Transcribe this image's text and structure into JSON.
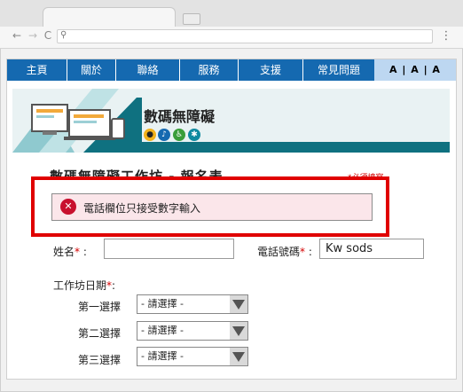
{
  "browser": {
    "back_glyph": "←",
    "forward_glyph": "→",
    "reload_glyph": "C",
    "search_glyph": "⚲",
    "menu_glyph": "⋮"
  },
  "navbar": {
    "items": [
      {
        "label": "主頁"
      },
      {
        "label": "關於"
      },
      {
        "label": "聯絡"
      },
      {
        "label": "服務"
      },
      {
        "label": "支援"
      },
      {
        "label": "常見問題"
      }
    ],
    "font_size_controls": "A | A | A",
    "color": "#1569b0"
  },
  "banner": {
    "title": "數碼無障礙",
    "icons": [
      "eye-icon",
      "hearing-icon",
      "wheelchair-icon",
      "cognitive-icon"
    ]
  },
  "form": {
    "title": "數碼無障礙工作坊 - 報名表",
    "required_note": "*必須填寫",
    "error_message": "電話欄位只接受數字輸入",
    "error_icon_glyph": "✕",
    "name_label": "姓名",
    "phone_label": "電話號碼",
    "required_marker": "*",
    "colon": ":",
    "name_value": "",
    "phone_value": "Kw sods",
    "date_label": "工作坊日期",
    "choices": [
      {
        "label": "第一選擇",
        "selected": "- 請選擇 -"
      },
      {
        "label": "第二選擇",
        "selected": "- 請選擇 -"
      },
      {
        "label": "第三選擇",
        "selected": "- 請選擇 -"
      }
    ]
  },
  "colors": {
    "error_red": "#e00000",
    "error_bg": "#fbe6ea",
    "banner_teal": "#0f7180"
  }
}
